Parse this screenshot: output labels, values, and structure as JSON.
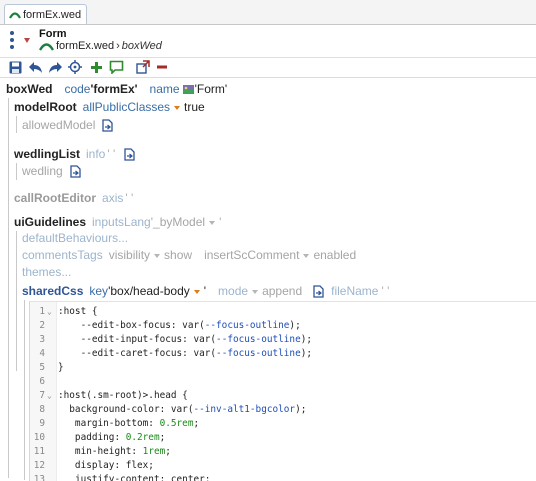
{
  "tab": {
    "label": "formEx.wed"
  },
  "header": {
    "kind": "Form",
    "file": "formEx.wed",
    "separator": "›",
    "element": "boxWed"
  },
  "toolbar": {
    "icons": [
      "save-icon",
      "undo-icon",
      "redo-icon",
      "target-icon",
      "add-icon",
      "comment-icon",
      "open-external-icon",
      "remove-icon"
    ],
    "colors": {
      "save": "#2f5597",
      "add": "#2e8b2e",
      "remove": "#a52a2a",
      "comment": "#2e8b2e"
    }
  },
  "tree": {
    "root": {
      "keyword": "boxWed",
      "code_label": "code",
      "code_value": "'formEx'",
      "name_label": "name",
      "name_value": "'Form'"
    },
    "modelRoot": {
      "keyword": "modelRoot",
      "feature": "allPublicClasses",
      "value": "true",
      "child": "allowedModel"
    },
    "wedlingList": {
      "keyword": "wedlingList",
      "info": "info",
      "info_value": "' '",
      "child": "wedling"
    },
    "callRootEditor": {
      "keyword": "callRootEditor",
      "axis": "axis",
      "axis_value": "' '"
    },
    "uiGuidelines": {
      "keyword": "uiGuidelines",
      "lang": "inputsLang",
      "lang_value": "'_byModel",
      "lang_tail": "'",
      "defaultBehaviours": "defaultBehaviours...",
      "comments": {
        "label": "commentsTags",
        "visibility": "visibility",
        "show": "show",
        "insert": "insertScComment",
        "enabled": "enabled"
      },
      "themes": "themes..."
    },
    "sharedCss": {
      "keyword": "sharedCss",
      "key": "key",
      "key_value": "'box/head-body",
      "key_tail": "'",
      "mode": "mode",
      "append": "append",
      "fileName": "fileName",
      "fileName_value": "' '"
    }
  },
  "code_lines": [
    {
      "n": "1",
      "fold": true,
      "tokens": [
        {
          "t": ":host {",
          "c": "c-sel"
        }
      ]
    },
    {
      "n": "2",
      "fold": false,
      "tokens": [
        {
          "t": "    --edit-box-focus: var(",
          "c": "c-prop"
        },
        {
          "t": "--focus-outline",
          "c": "c-var"
        },
        {
          "t": ");",
          "c": "c-prop"
        }
      ]
    },
    {
      "n": "3",
      "fold": false,
      "tokens": [
        {
          "t": "    --edit-input-focus: var(",
          "c": "c-prop"
        },
        {
          "t": "--focus-outline",
          "c": "c-var"
        },
        {
          "t": ");",
          "c": "c-prop"
        }
      ]
    },
    {
      "n": "4",
      "fold": false,
      "tokens": [
        {
          "t": "    --edit-caret-focus: var(",
          "c": "c-prop"
        },
        {
          "t": "--focus-outline",
          "c": "c-var"
        },
        {
          "t": ");",
          "c": "c-prop"
        }
      ]
    },
    {
      "n": "5",
      "fold": false,
      "tokens": [
        {
          "t": "}",
          "c": "c-sel"
        }
      ]
    },
    {
      "n": "6",
      "fold": false,
      "tokens": []
    },
    {
      "n": "7",
      "fold": true,
      "tokens": [
        {
          "t": ":host(.sm-root)>.head {",
          "c": "c-sel"
        }
      ]
    },
    {
      "n": "8",
      "fold": false,
      "tokens": [
        {
          "t": "  background-color: var(",
          "c": "c-prop"
        },
        {
          "t": "--inv-alt1-bgcolor",
          "c": "c-var"
        },
        {
          "t": ");",
          "c": "c-prop"
        }
      ]
    },
    {
      "n": "9",
      "fold": false,
      "tokens": [
        {
          "t": "   margin-bottom: ",
          "c": "c-prop"
        },
        {
          "t": "0.5rem",
          "c": "c-num"
        },
        {
          "t": ";",
          "c": "c-prop"
        }
      ]
    },
    {
      "n": "10",
      "fold": false,
      "tokens": [
        {
          "t": "   padding: ",
          "c": "c-prop"
        },
        {
          "t": "0.2rem",
          "c": "c-num"
        },
        {
          "t": ";",
          "c": "c-prop"
        }
      ]
    },
    {
      "n": "11",
      "fold": false,
      "tokens": [
        {
          "t": "   min-height: ",
          "c": "c-prop"
        },
        {
          "t": "1rem",
          "c": "c-num"
        },
        {
          "t": ";",
          "c": "c-prop"
        }
      ]
    },
    {
      "n": "12",
      "fold": false,
      "tokens": [
        {
          "t": "   display: flex;",
          "c": "c-prop"
        }
      ]
    },
    {
      "n": "13",
      "fold": false,
      "tokens": [
        {
          "t": "   justify-content: center;",
          "c": "c-prop"
        }
      ]
    }
  ]
}
